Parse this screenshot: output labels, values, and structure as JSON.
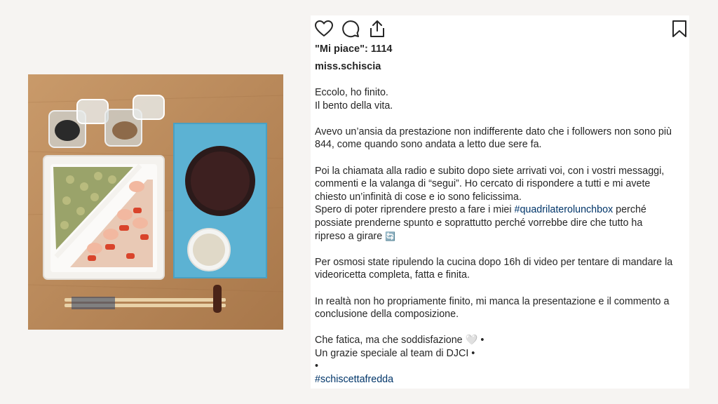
{
  "post": {
    "likes_text": "\"Mi piace\": 1114",
    "username": "miss.schiscia",
    "caption": {
      "l1": "Eccolo, ho finito.",
      "l2": "Il bento della vita.",
      "l3": "Avevo un’ansia da prestazione non indifferente dato che i followers non sono più",
      "l4": "844, come quando sono andata a letto due sere fa.",
      "l5": "Poi la chiamata alla radio e subito dopo siete arrivati voi, con i vostri messaggi,",
      "l6": "commenti e la valanga di “segui”. Ho cercato di rispondere a tutti e mi avete",
      "l7": "chiesto un’infinità di cose e io sono felicissima.",
      "l8a": "Spero di poter riprendere presto a fare i miei ",
      "l8tag": "#quadrilaterolunchbox",
      "l8b": " perché",
      "l9": "possiate prenderne spunto e soprattutto perché vorrebbe dire che tutto ha",
      "l10": "ripreso a girare",
      "l10emoji": "🔄",
      "l11": "Per osmosi state ripulendo la cucina dopo 16h di video per tentare di mandare la",
      "l12": "videoricetta completa, fatta e finita.",
      "l13": "In realtà non ho propriamente finito, mi manca la presentazione e il commento a",
      "l14": "conclusione della composizione.",
      "l15": "Che fatica, ma che soddisfazione 🤍 •",
      "l16": "Un grazie speciale al team di DJCI •",
      "l17": "•",
      "l18": "#schiscettafredda"
    }
  },
  "icons": {
    "like": "heart-icon",
    "comment": "comment-icon",
    "share": "share-icon",
    "save": "bookmark-icon",
    "next": "chevron-right-icon"
  },
  "carousel": {
    "slides": 4,
    "active": 1
  },
  "colors": {
    "background": "#f6f4f2",
    "text": "#262626",
    "hashtag": "#003569",
    "active_dot": "#3897f0"
  }
}
